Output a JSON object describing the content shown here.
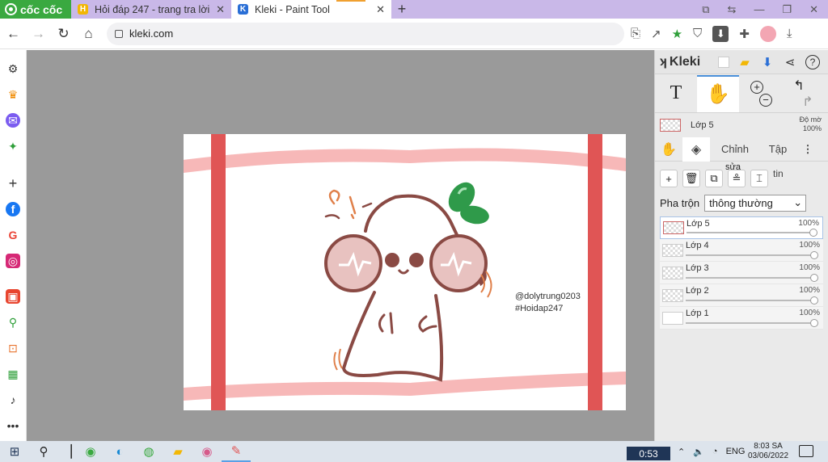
{
  "browser": {
    "brand": "cốc cốc",
    "tabs": [
      {
        "title": "Hỏi đáp 247 - trang tra lời",
        "fav_letter": "H",
        "fav_color": "#f2b705"
      },
      {
        "title": "Kleki - Paint Tool",
        "fav_letter": "K",
        "fav_color": "#2a6fd6"
      }
    ],
    "new_tab": "+",
    "url": "kleki.com"
  },
  "canvas": {
    "watermark_line1": "@dolytrung0203",
    "watermark_line2": "#Hoidap247",
    "colors": {
      "frame": "#e05555",
      "frame_soft": "#f4a0a0",
      "outline": "#8a4a44",
      "cheek": "#e8c2c0",
      "leaf": "#2f9a4a"
    }
  },
  "kleki": {
    "logo": "Kleki",
    "layer_current": "Lớp 5",
    "opacity_label_1": "Độ mờ",
    "opacity_label_2": "100%",
    "subtabs": {
      "adjust": "Chỉnh",
      "file": "Tập",
      "tin": "tin",
      "sua": "sửa"
    },
    "blend_label": "Pha trộn",
    "blend_value": "thông thường",
    "layers": [
      {
        "name": "Lớp 5",
        "opacity": "100%",
        "selected": true
      },
      {
        "name": "Lớp 4",
        "opacity": "100%",
        "selected": false
      },
      {
        "name": "Lớp 3",
        "opacity": "100%",
        "selected": false
      },
      {
        "name": "Lớp 2",
        "opacity": "100%",
        "selected": false
      },
      {
        "name": "Lớp 1",
        "opacity": "100%",
        "selected": false
      }
    ]
  },
  "taskbar": {
    "timer": "0:53",
    "lang": "ENG",
    "time": "8:03 SA",
    "date": "03/06/2022"
  }
}
